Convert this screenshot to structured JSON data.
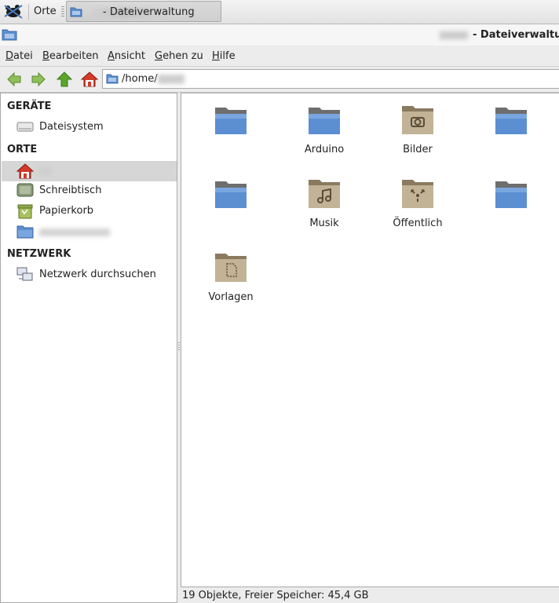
{
  "panel": {
    "places_label": "Orte",
    "task_title": "- Dateiverwaltung"
  },
  "window": {
    "title": "- Dateiverwaltung"
  },
  "menu": {
    "items": [
      {
        "first": "D",
        "rest": "atei"
      },
      {
        "first": "B",
        "rest": "earbeiten"
      },
      {
        "first": "A",
        "rest": "nsicht"
      },
      {
        "first": "G",
        "rest": "ehen zu"
      },
      {
        "first": "H",
        "rest": "ilfe"
      }
    ]
  },
  "location": {
    "path": "/home/"
  },
  "sidebar": {
    "devices_header": "GERÄTE",
    "places_header": "ORTE",
    "network_header": "NETZWERK",
    "devices": [
      {
        "label": "Dateisystem",
        "icon": "drive-icon"
      }
    ],
    "places": [
      {
        "label": "",
        "icon": "home-icon",
        "selected": true
      },
      {
        "label": "Schreibtisch",
        "icon": "desktop-icon"
      },
      {
        "label": "Papierkorb",
        "icon": "trash-icon"
      },
      {
        "label": "",
        "icon": "folder-icon"
      }
    ],
    "network": [
      {
        "label": "Netzwerk durchsuchen",
        "icon": "network-icon"
      }
    ]
  },
  "files": [
    {
      "name": "",
      "kind": "folder-blue"
    },
    {
      "name": "Arduino",
      "kind": "folder-blue"
    },
    {
      "name": "Bilder",
      "kind": "folder-pictures"
    },
    {
      "name": "",
      "kind": "folder-blue"
    },
    {
      "name": "",
      "kind": "folder-blue"
    },
    {
      "name": "Musik",
      "kind": "folder-music"
    },
    {
      "name": "Öffentlich",
      "kind": "folder-public"
    },
    {
      "name": "",
      "kind": "folder-blue"
    },
    {
      "name": "Vorlagen",
      "kind": "folder-templates"
    }
  ],
  "status": {
    "text": "19 Objekte, Freier Speicher: 45,4 GB"
  },
  "colors": {
    "folder_blue": "#5b8fd2",
    "folder_tan": "#b9a88c",
    "home_red": "#d23a2a",
    "arrow_green": "#5aa52a"
  }
}
